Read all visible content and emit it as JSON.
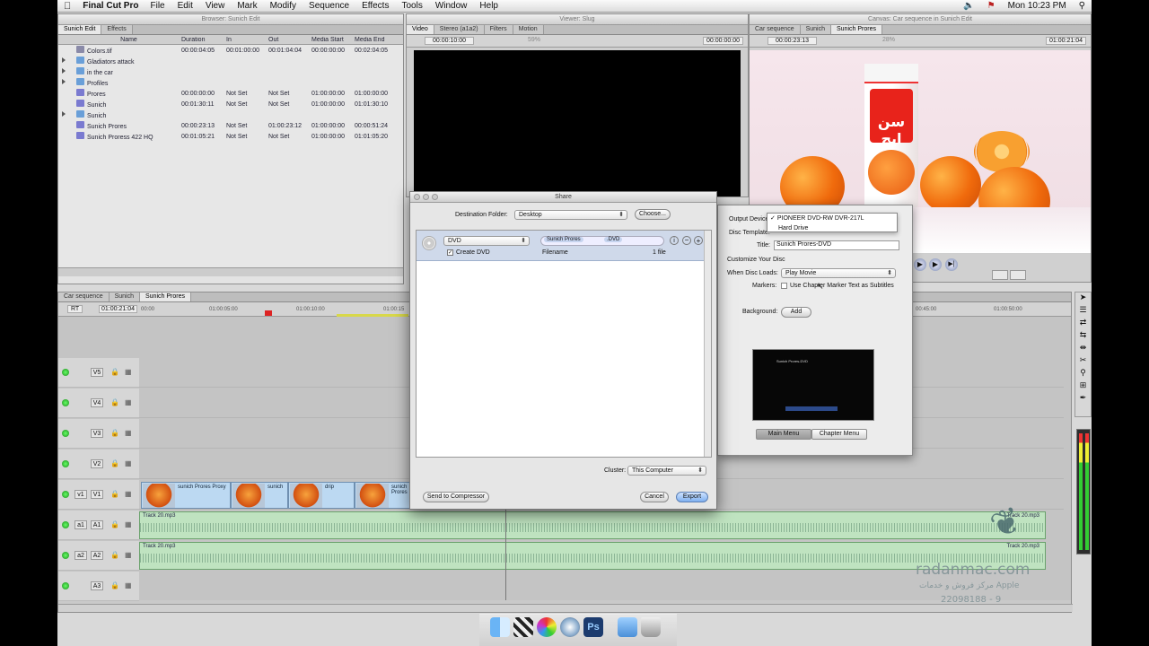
{
  "menubar": {
    "app": "Final Cut Pro",
    "items": [
      "File",
      "Edit",
      "View",
      "Mark",
      "Modify",
      "Sequence",
      "Effects",
      "Tools",
      "Window",
      "Help"
    ],
    "clock": "Mon 10:23 PM"
  },
  "browser": {
    "title": "Browser: Sunich Edit",
    "tabs": [
      "Sunich Edit",
      "Effects"
    ],
    "columns": [
      "Name",
      "Duration",
      "In",
      "Out",
      "Media Start",
      "Media End"
    ],
    "rows": [
      {
        "name": "Colors.tif",
        "duration": "00:00:04:05",
        "in": "00:01:00:00",
        "out": "00:01:04:04",
        "ms": "00:00:00:00",
        "me": "00:02:04:05",
        "kind": "file"
      },
      {
        "name": "Gladiators attack",
        "duration": "",
        "in": "",
        "out": "",
        "ms": "",
        "me": "",
        "kind": "folder"
      },
      {
        "name": "in the car",
        "duration": "",
        "in": "",
        "out": "",
        "ms": "",
        "me": "",
        "kind": "folder"
      },
      {
        "name": "Profiles",
        "duration": "",
        "in": "",
        "out": "",
        "ms": "",
        "me": "",
        "kind": "folder"
      },
      {
        "name": "Prores",
        "duration": "00:00:00:00",
        "in": "Not Set",
        "out": "Not Set",
        "ms": "01:00:00:00",
        "me": "01:00:00:00",
        "kind": "seq"
      },
      {
        "name": "Sunich",
        "duration": "00:01:30:11",
        "in": "Not Set",
        "out": "Not Set",
        "ms": "01:00:00:00",
        "me": "01:01:30:10",
        "kind": "seq"
      },
      {
        "name": "Sunich",
        "duration": "",
        "in": "",
        "out": "",
        "ms": "",
        "me": "",
        "kind": "folder"
      },
      {
        "name": "Sunich Prores",
        "duration": "00:00:23:13",
        "in": "Not Set",
        "out": "01:00:23:12",
        "ms": "01:00:00:00",
        "me": "00:00:51:24",
        "kind": "seq"
      },
      {
        "name": "Sunich Proress 422 HQ",
        "duration": "00:01:05:21",
        "in": "Not Set",
        "out": "Not Set",
        "ms": "01:00:00:00",
        "me": "01:01:05:20",
        "kind": "seq"
      }
    ]
  },
  "viewer": {
    "title": "Viewer: Slug",
    "tabs": [
      "Video",
      "Stereo (a1a2)",
      "Filters",
      "Motion"
    ],
    "tc_left": "00:00:10:00",
    "zoom": "59%",
    "tc_right": "00:00:00:00"
  },
  "canvas": {
    "title": "Canvas: Car sequence in Sunich Edit",
    "tabs": [
      "Car sequence",
      "Sunich",
      "Sunich Prores"
    ],
    "tc_left": "00:00:23:13",
    "zoom": "28%",
    "tc_right": "01:00:21:04",
    "carton_text": "سن ایچ"
  },
  "timeline": {
    "tabs": [
      "Car sequence",
      "Sunich",
      "Sunich Prores"
    ],
    "rt": "RT",
    "timecode": "01:00:21:04",
    "ruler": [
      "00:00",
      "01:00:05:00",
      "01:00:10:00",
      "01:00:15",
      "00:45:00",
      "01:00:50:00"
    ],
    "video_tracks": [
      {
        "label": "V5"
      },
      {
        "label": "V4"
      },
      {
        "label": "V3"
      },
      {
        "label": "V2"
      },
      {
        "label": "V1",
        "src": "v1"
      }
    ],
    "video_clips": [
      "sunich Prores Proxy",
      "sunich",
      "drip",
      "sunich Prores"
    ],
    "audio_tracks": [
      {
        "src": "a1",
        "label": "A1",
        "clip": "Track 20.mp3",
        "clip_right": "Track 20.mp3"
      },
      {
        "src": "a2",
        "label": "A2",
        "clip": "Track 20.mp3",
        "clip_right": "Track 20.mp3"
      },
      {
        "src": "",
        "label": "A3",
        "clip": "",
        "clip_right": ""
      }
    ]
  },
  "share": {
    "title": "Share",
    "dest_label": "Destination Folder:",
    "dest_value": "Desktop",
    "choose": "Choose...",
    "format": "DVD",
    "pill_name": "Sunich Prores",
    "pill_ext": ".DVD",
    "create_dvd": "Create DVD",
    "filename_label": "Filename",
    "files": "1 file",
    "cluster_label": "Cluster:",
    "cluster_value": "This Computer",
    "send_compressor": "Send to Compressor",
    "cancel": "Cancel",
    "export": "Export"
  },
  "dvd_panel": {
    "output_device_label": "Output Device:",
    "devices": [
      "PIONEER DVD-RW  DVR-217L",
      "Hard Drive"
    ],
    "device_selected": "✓",
    "disc_template_label": "Disc Template:",
    "title_label": "Title:",
    "title_value": "Sunich Prores-DVD",
    "customize": "Customize Your Disc",
    "when_loads_label": "When Disc Loads:",
    "when_loads_value": "Play Movie",
    "markers_label": "Markers:",
    "markers_option": "Use Chapter Marker Text as Subtitles",
    "background_label": "Background:",
    "add": "Add",
    "preview_title": "Sunich Prores-DVD",
    "main_menu": "Main Menu",
    "chapter_menu": "Chapter Menu"
  },
  "watermark": {
    "site": "radanmac.com",
    "tagline": "مرکز فروش و خدمات Apple",
    "phone": "22098188 - 9"
  }
}
